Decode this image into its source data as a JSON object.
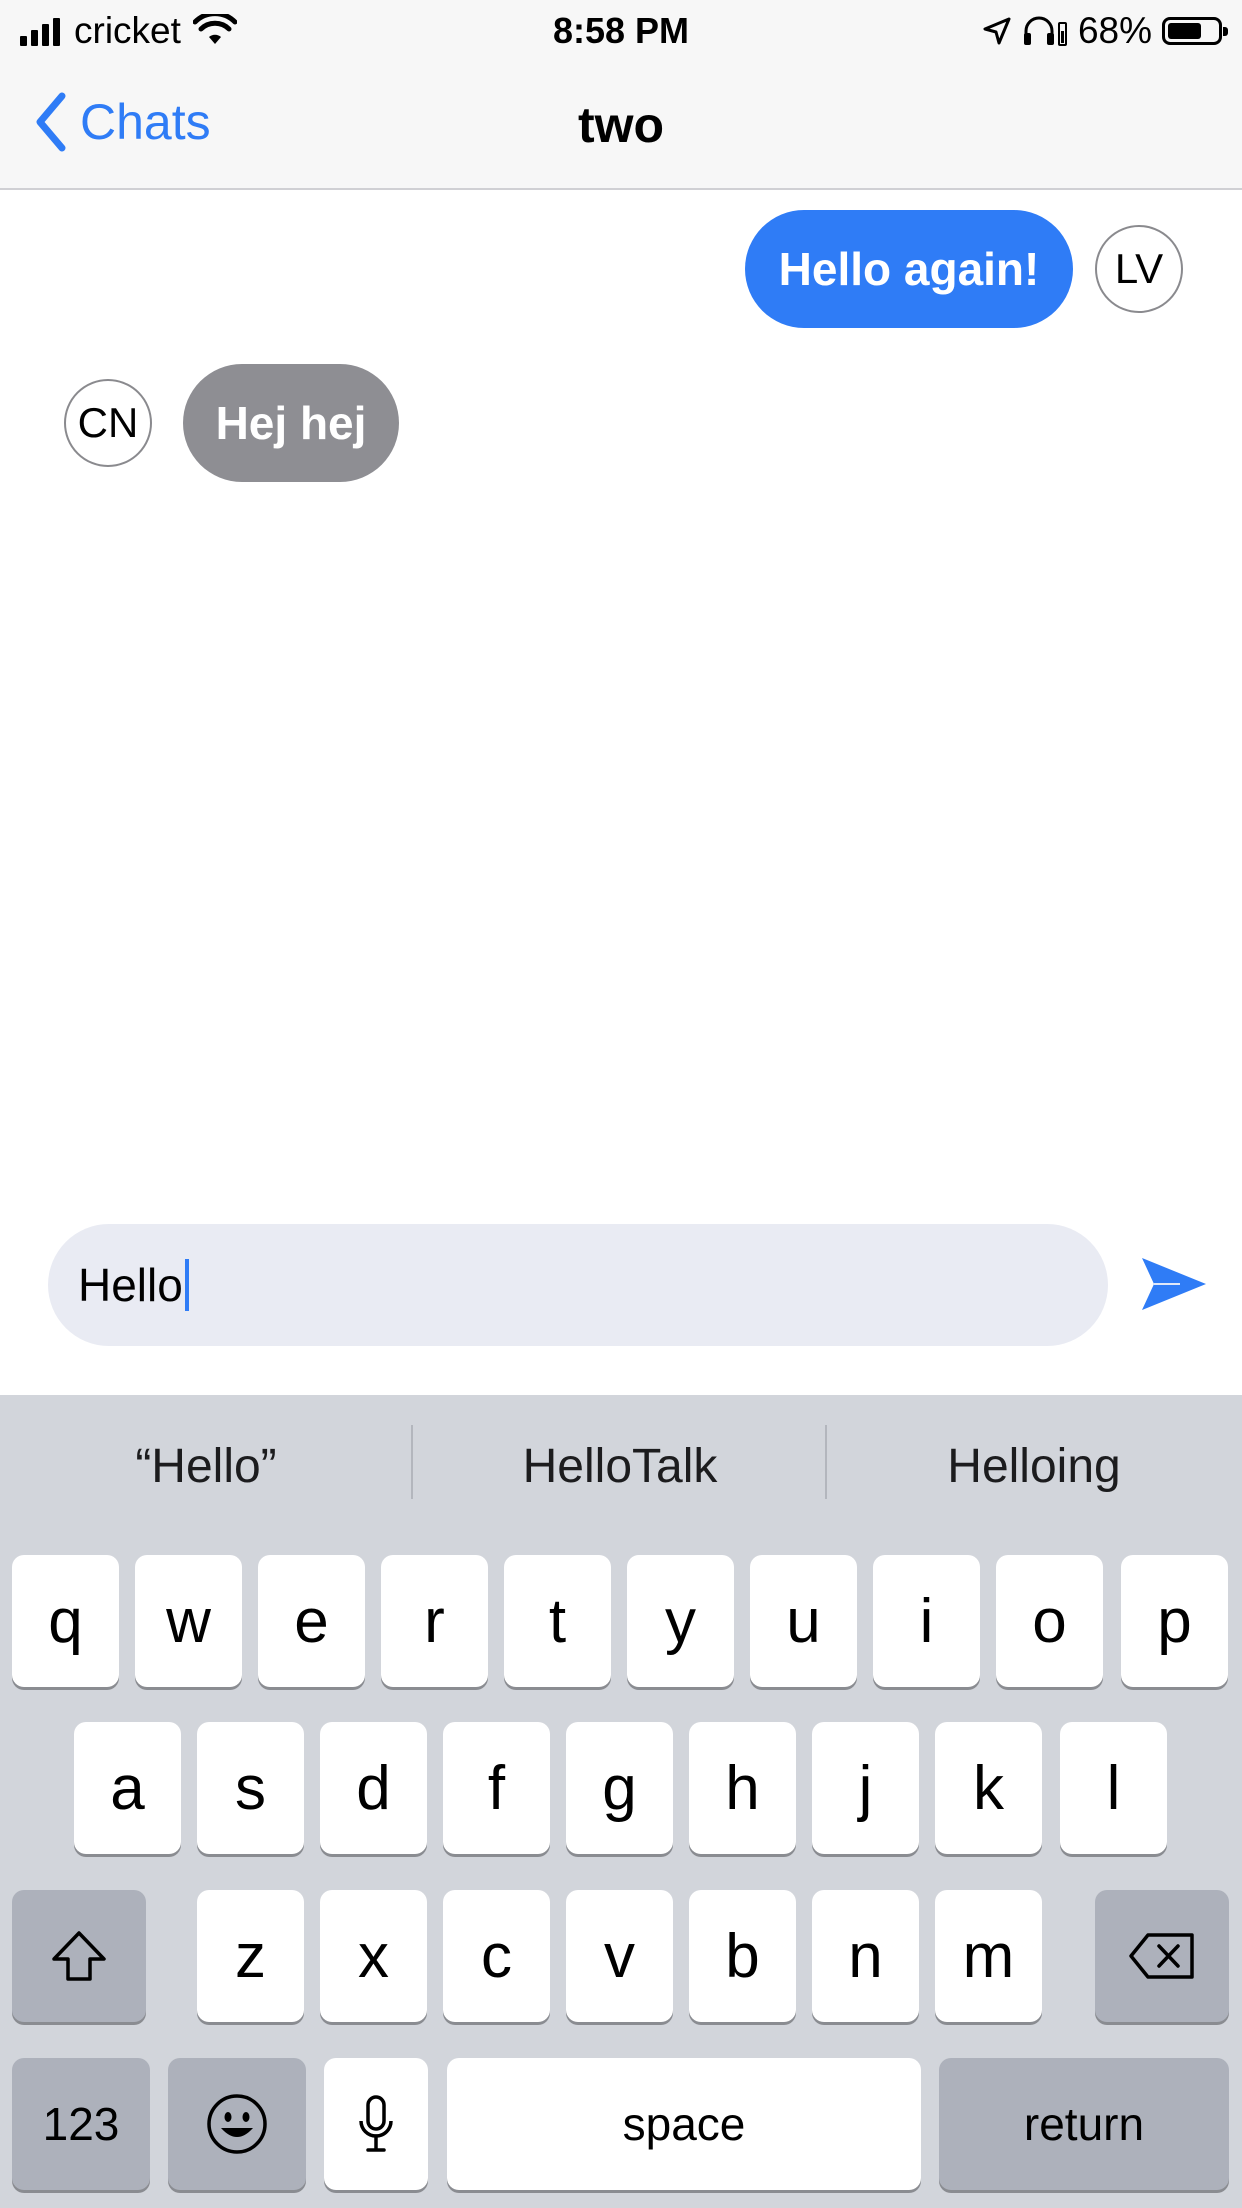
{
  "status_bar": {
    "carrier": "cricket",
    "time": "8:58 PM",
    "battery": "68%",
    "battery_level": 0.68,
    "icons": [
      "signal-icon",
      "wifi-icon",
      "location-icon",
      "headphones-icon",
      "battery-icon"
    ]
  },
  "nav": {
    "back_label": "Chats",
    "title": "two"
  },
  "messages": [
    {
      "direction": "outgoing",
      "text": "Hello again!",
      "avatar": "LV"
    },
    {
      "direction": "incoming",
      "text": "Hej hej",
      "avatar": "CN"
    }
  ],
  "composer": {
    "value": "Hello",
    "send_icon": "send-icon"
  },
  "keyboard": {
    "suggestions": [
      "“Hello”",
      "HelloTalk",
      "Helloing"
    ],
    "row1": [
      "q",
      "w",
      "e",
      "r",
      "t",
      "y",
      "u",
      "i",
      "o",
      "p"
    ],
    "row2": [
      "a",
      "s",
      "d",
      "f",
      "g",
      "h",
      "j",
      "k",
      "l"
    ],
    "row3": [
      "z",
      "x",
      "c",
      "v",
      "b",
      "n",
      "m"
    ],
    "numbers_label": "123",
    "space_label": "space",
    "return_label": "return"
  },
  "colors": {
    "accent": "#2f7cf6",
    "incoming_bubble": "#8e8e93",
    "composer_bg": "#e9ebf3",
    "keyboard_bg": "#d2d5db"
  }
}
